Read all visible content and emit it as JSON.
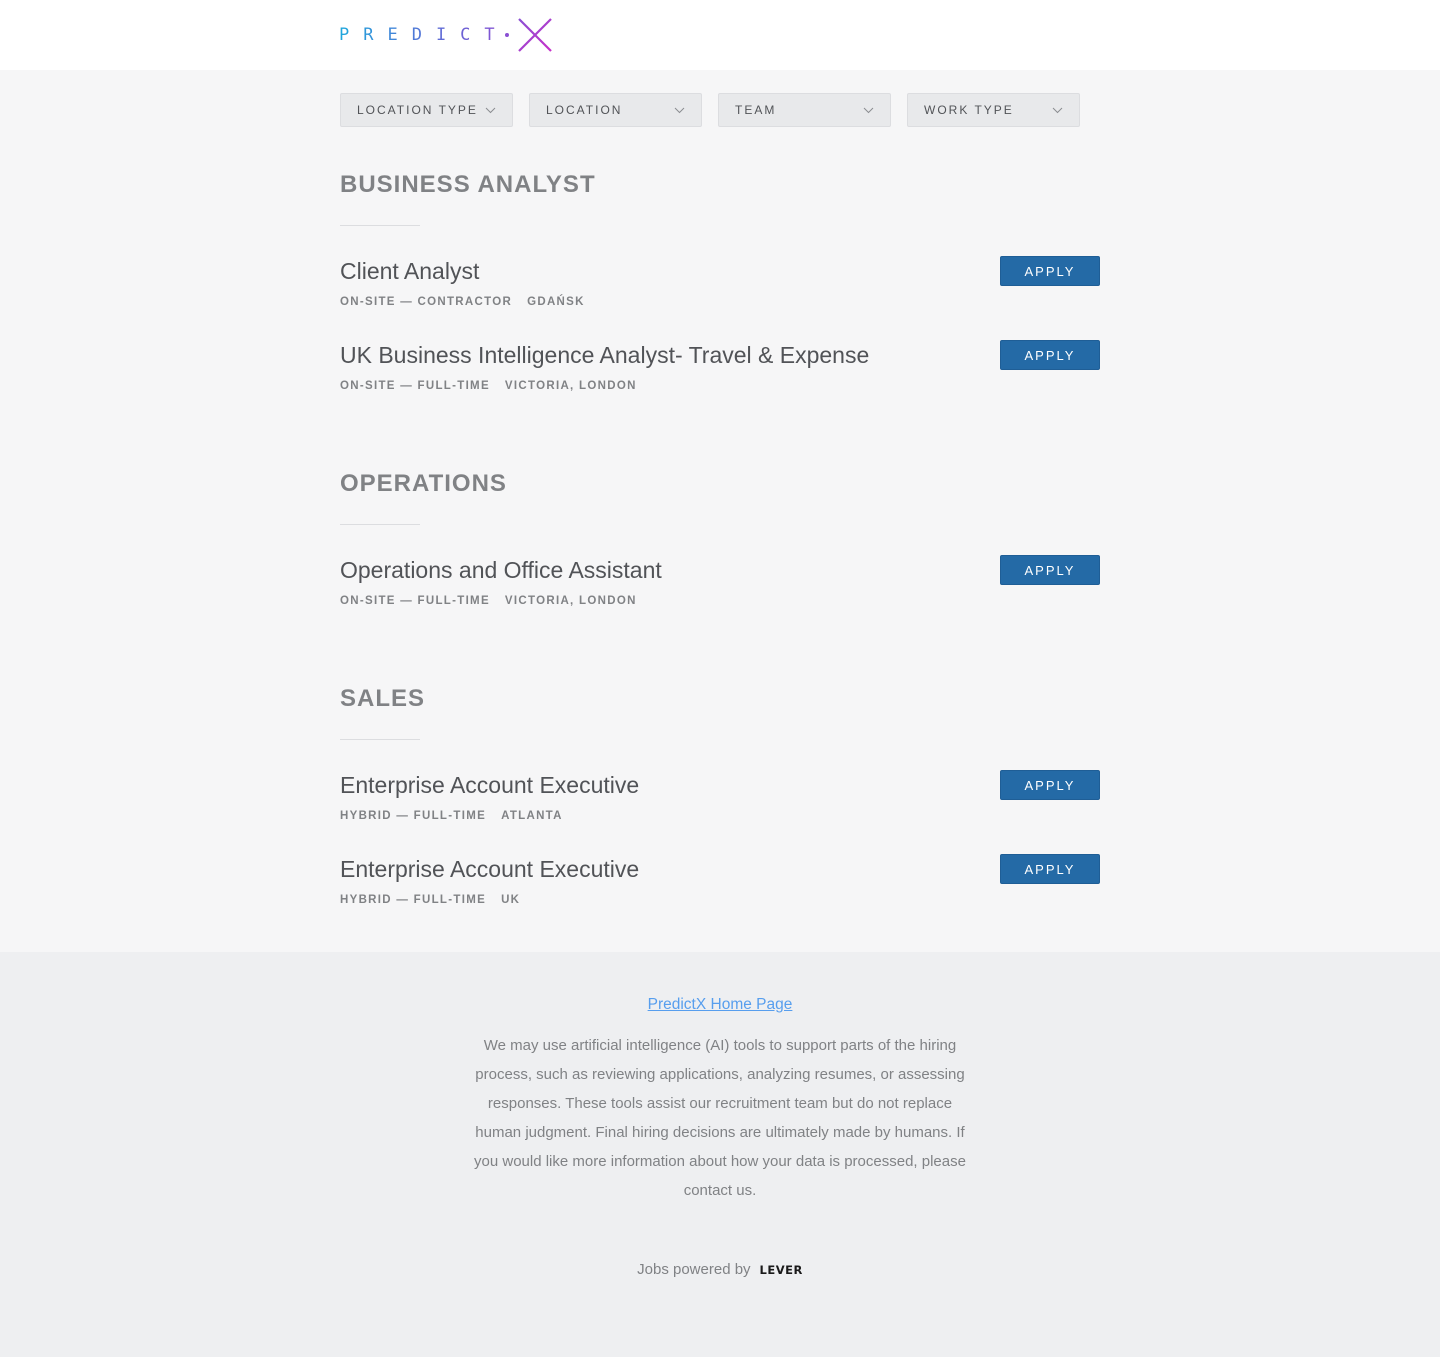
{
  "brand": {
    "logo_text": "PREDICT",
    "accent_colors": [
      "#1ea7dc",
      "#8a4fd3",
      "#c72fc9"
    ]
  },
  "filters": [
    {
      "label": "LOCATION TYPE"
    },
    {
      "label": "LOCATION"
    },
    {
      "label": "TEAM"
    },
    {
      "label": "WORK TYPE"
    }
  ],
  "apply_label": "APPLY",
  "groups": [
    {
      "title": "BUSINESS ANALYST",
      "postings": [
        {
          "title": "Client Analyst",
          "commitment": "ON-SITE — CONTRACTOR",
          "location": "GDAŃSK"
        },
        {
          "title": "UK Business Intelligence Analyst- Travel & Expense",
          "commitment": "ON-SITE — FULL-TIME",
          "location": "VICTORIA, LONDON"
        }
      ]
    },
    {
      "title": "OPERATIONS",
      "postings": [
        {
          "title": "Operations and Office Assistant",
          "commitment": "ON-SITE — FULL-TIME",
          "location": "VICTORIA, LONDON"
        }
      ]
    },
    {
      "title": "SALES",
      "postings": [
        {
          "title": "Enterprise Account Executive",
          "commitment": "HYBRID — FULL-TIME",
          "location": "ATLANTA"
        },
        {
          "title": "Enterprise Account Executive",
          "commitment": "HYBRID — FULL-TIME",
          "location": "UK"
        }
      ]
    }
  ],
  "footer": {
    "home_link": "PredictX Home Page",
    "disclaimer": "We may use artificial intelligence (AI) tools to support parts of the hiring process, such as reviewing applications, analyzing resumes, or assessing responses. These tools assist our recruitment team but do not replace human judgment. Final hiring decisions are ultimately made by humans. If you would like more information about how your data is processed, please contact us.",
    "powered_by": "Jobs powered by",
    "lever_logo": "LEVER"
  },
  "colors": {
    "apply_button": "#246aa6",
    "link": "#579eee",
    "page_background": "#f6f6f7",
    "footer_background": "#eeeff1"
  }
}
